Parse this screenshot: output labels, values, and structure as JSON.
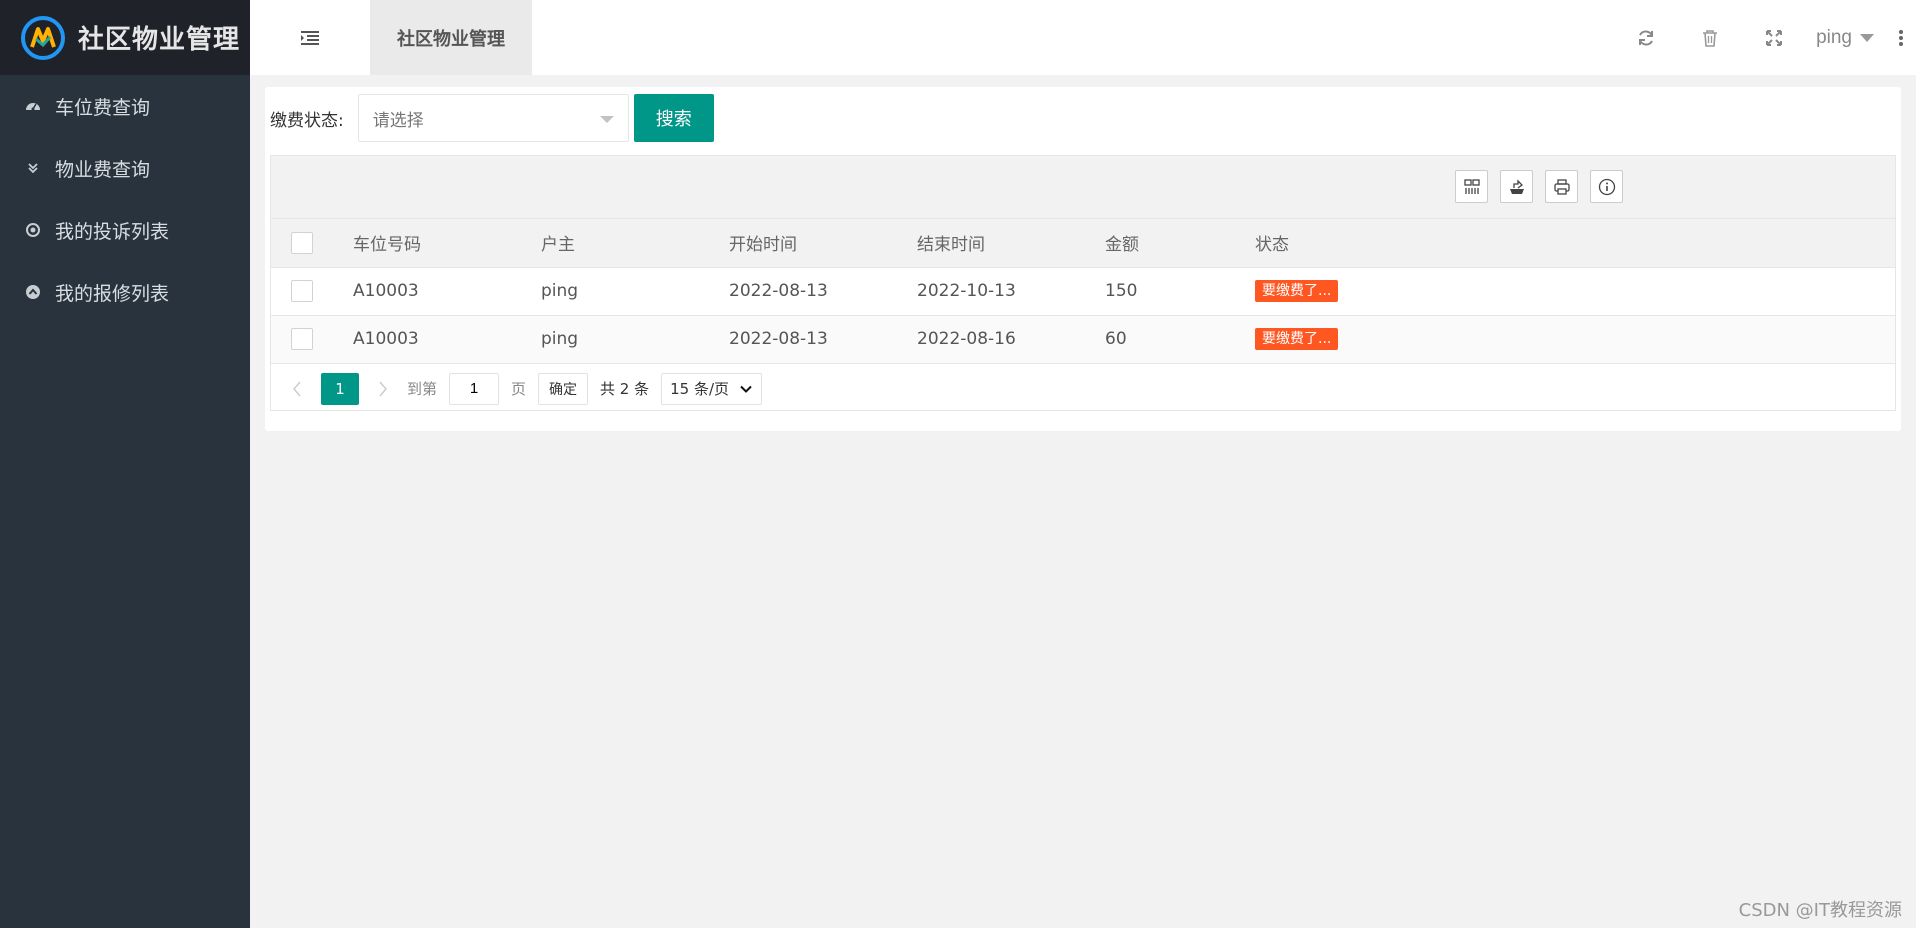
{
  "app": {
    "title": "社区物业管理"
  },
  "sidebar": {
    "items": [
      {
        "label": "车位费查询",
        "icon": "dashboard-icon"
      },
      {
        "label": "物业费查询",
        "icon": "double-chevron-down-icon"
      },
      {
        "label": "我的投诉列表",
        "icon": "circle-dot-icon"
      },
      {
        "label": "我的报修列表",
        "icon": "circle-up-icon"
      }
    ]
  },
  "header": {
    "active_tab": "社区物业管理",
    "user": "ping",
    "icons": [
      "refresh-icon",
      "trash-icon",
      "fullscreen-icon",
      "more-vertical-icon"
    ]
  },
  "search": {
    "label": "缴费状态:",
    "placeholder": "请选择",
    "button": "搜索"
  },
  "table": {
    "toolbar_icons": [
      "columns-icon",
      "export-icon",
      "print-icon",
      "info-icon"
    ],
    "columns": [
      "车位号码",
      "户主",
      "开始时间",
      "结束时间",
      "金额",
      "状态"
    ],
    "rows": [
      {
        "space": "A10003",
        "owner": "ping",
        "start": "2022-08-13",
        "end": "2022-10-13",
        "amount": "150",
        "status": "要缴费了..."
      },
      {
        "space": "A10003",
        "owner": "ping",
        "start": "2022-08-13",
        "end": "2022-08-16",
        "amount": "60",
        "status": "要缴费了..."
      }
    ],
    "status_color": "#ff5722"
  },
  "pager": {
    "current": "1",
    "goto_label": "到第",
    "goto_value": "1",
    "page_unit": "页",
    "confirm": "确定",
    "total": "共 2 条",
    "page_size": "15 条/页"
  },
  "colors": {
    "accent": "#009688",
    "sidebar": "#28333e",
    "logo_bar": "#20222a"
  },
  "watermark": "CSDN @IT教程资源"
}
